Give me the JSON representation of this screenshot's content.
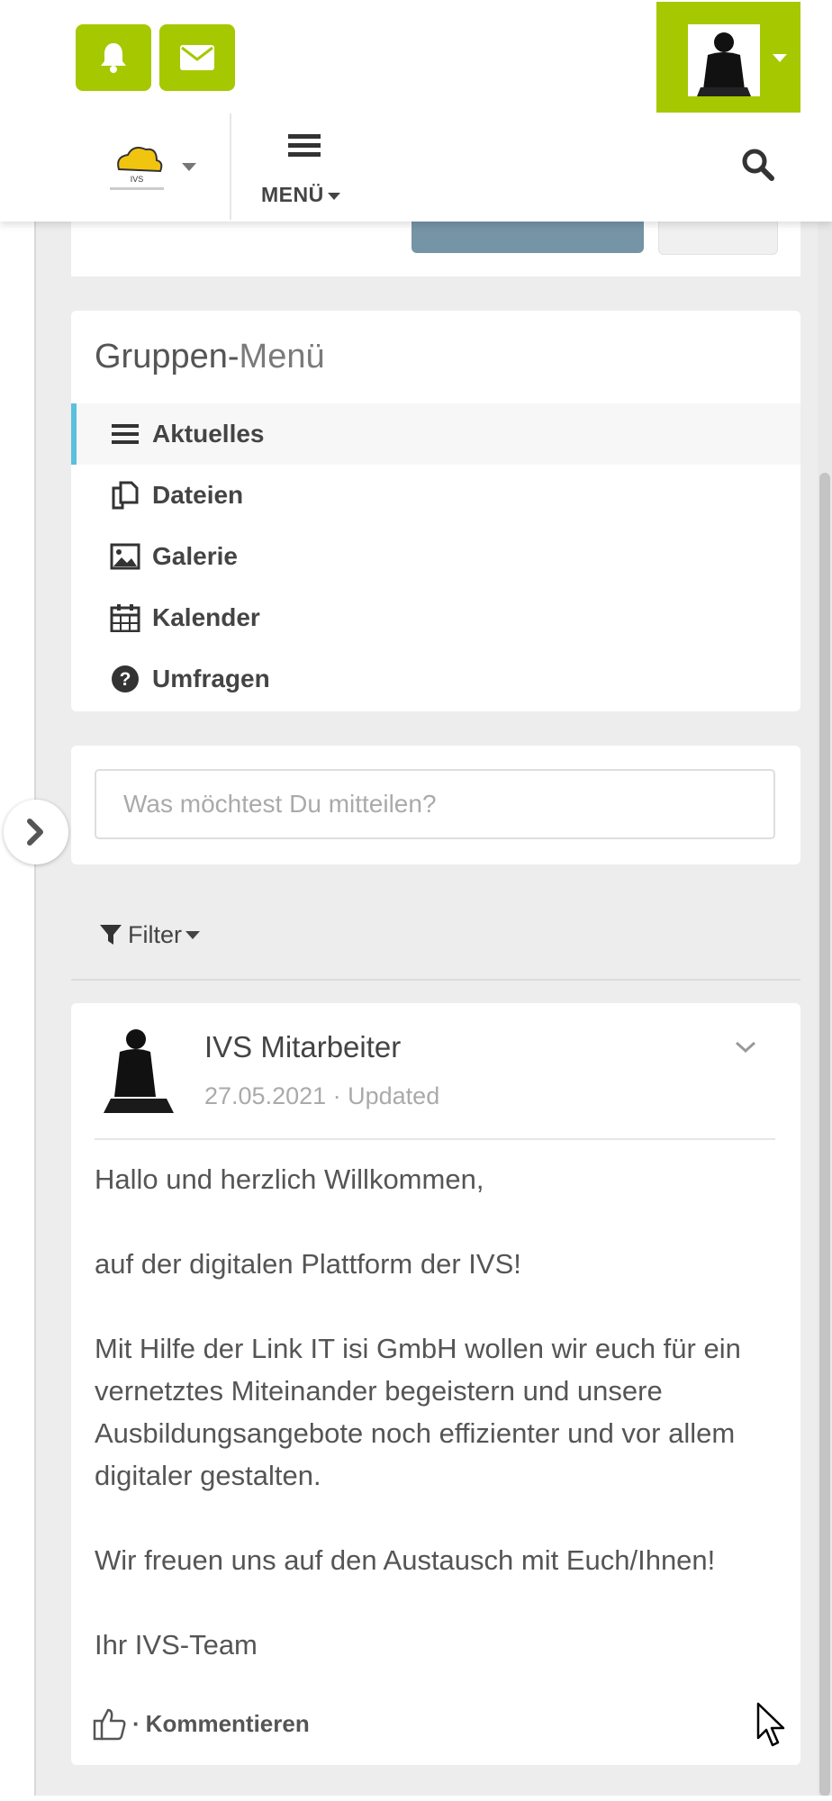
{
  "header": {
    "menu_label": "MENÜ",
    "logo_text": "IVS",
    "icons": {
      "bell": "bell-icon",
      "mail": "envelope-icon",
      "search": "search-icon",
      "menu": "hamburger-icon"
    },
    "accent_color": "#a6c800"
  },
  "group_menu": {
    "title_bold": "Gruppen-",
    "title_light": "Menü",
    "items": [
      {
        "label": "Aktuelles",
        "icon": "list-icon",
        "active": true
      },
      {
        "label": "Dateien",
        "icon": "files-icon",
        "active": false
      },
      {
        "label": "Galerie",
        "icon": "image-icon",
        "active": false
      },
      {
        "label": "Kalender",
        "icon": "calendar-icon",
        "active": false
      },
      {
        "label": "Umfragen",
        "icon": "question-circle-icon",
        "active": false
      }
    ],
    "active_color": "#5bc0de"
  },
  "composer": {
    "placeholder": "Was möchtest Du mitteilen?"
  },
  "filter": {
    "label": "Filter"
  },
  "post": {
    "author": "IVS Mitarbeiter",
    "meta": "27.05.2021 · Updated",
    "paragraphs": [
      "Hallo und herzlich Willkommen,",
      "auf der digitalen Plattform der IVS!",
      "Mit Hilfe der Link IT isi GmbH wollen wir euch für ein vernetztes Miteinander begeistern und unsere Ausbildungsangebote noch effizienter und vor allem digitaler gestalten.",
      "Wir freuen uns auf den Austausch mit Euch/Ihnen!",
      "Ihr IVS-Team"
    ],
    "actions": {
      "separator": "·",
      "comment": "Kommentieren"
    }
  }
}
